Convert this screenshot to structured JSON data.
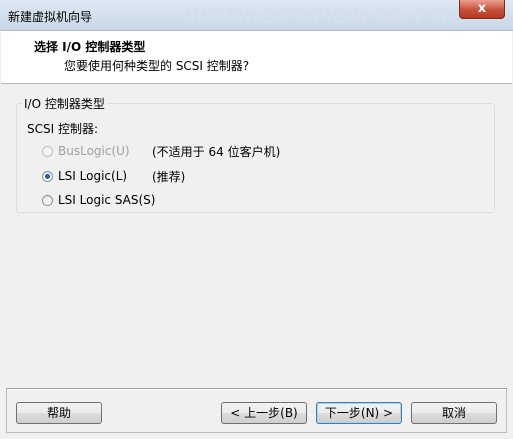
{
  "window": {
    "title": "新建虚拟机向导",
    "watermark": "WORKSTATION 15 PRO",
    "close_glyph": "x"
  },
  "header": {
    "title": "选择 I/O 控制器类型",
    "subtitle": "您要使用何种类型的 SCSI 控制器?"
  },
  "group": {
    "label": "I/O 控制器类型",
    "scsi_label": "SCSI 控制器:",
    "options": [
      {
        "label": "BusLogic(U)",
        "note": "(不适用于 64 位客户机)",
        "state": "disabled"
      },
      {
        "label": "LSI Logic(L)",
        "note": "(推荐)",
        "state": "checked"
      },
      {
        "label": "LSI Logic SAS(S)",
        "note": "",
        "state": "unchecked"
      }
    ]
  },
  "footer": {
    "help": "帮助",
    "back": "< 上一步(B)",
    "next": "下一步(N) >",
    "cancel": "取消"
  }
}
